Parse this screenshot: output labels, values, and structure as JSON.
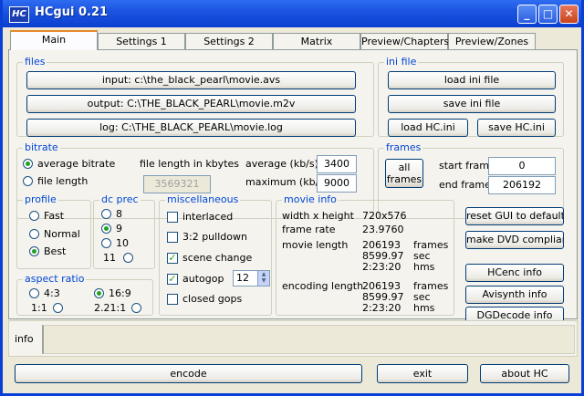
{
  "window": {
    "title": "HCgui 0.21",
    "icon_text": "HC",
    "minimize": "_",
    "maximize": "□",
    "close": "✕",
    "accent": "#0a3fd6"
  },
  "tabs": [
    "Main",
    "Settings 1",
    "Settings 2",
    "Matrix",
    "Preview/Chapters",
    "Preview/Zones"
  ],
  "files": {
    "title": "files",
    "input": "input: c:\\the_black_pearl\\movie.avs",
    "output": "output: C:\\THE_BLACK_PEARL\\movie.m2v",
    "log": "log: C:\\THE_BLACK_PEARL\\movie.log"
  },
  "ini": {
    "title": "ini file",
    "load": "load ini file",
    "save": "save ini file",
    "load_hc": "load HC.ini",
    "save_hc": "save HC.ini"
  },
  "bitrate": {
    "title": "bitrate",
    "average": "average bitrate",
    "file_length": "file length",
    "file_length_label": "file length in kbytes",
    "file_length_value": "3569321",
    "average_label": "average (kb/s)",
    "average_value": "3400",
    "maximum_label": "maximum (kb/s)",
    "maximum_value": "9000"
  },
  "frames": {
    "title": "frames",
    "all": "all\nframes",
    "start_label": "start frame",
    "start_value": "0",
    "end_label": "end frame",
    "end_value": "206192"
  },
  "profile": {
    "title": "profile",
    "fast": "Fast",
    "normal": "Normal",
    "best": "Best"
  },
  "dcprec": {
    "title": "dc prec",
    "v8": "8",
    "v9": "9",
    "v10": "10",
    "v11": "11"
  },
  "misc": {
    "title": "miscellaneous",
    "interlaced": "interlaced",
    "pulldown": "3:2 pulldown",
    "scene": "scene change",
    "autogop": "autogop",
    "autogop_value": "12",
    "closed": "closed gops"
  },
  "aspect": {
    "title": "aspect ratio",
    "a43": "4:3",
    "a169": "16:9",
    "a11": "1:1",
    "a221": "2.21:1"
  },
  "movie": {
    "title": "movie info",
    "wh_label": "width x height",
    "wh": "720x576",
    "fr_label": "frame rate",
    "fr": "23.9760",
    "ml_label": "movie length",
    "ml_frames": "206193",
    "ml_sec": "8599.97",
    "ml_hms": "2:23:20",
    "el_label": "encoding length",
    "el_frames": "206193",
    "el_sec": "8599.97",
    "el_hms": "2:23:20",
    "u_frames": "frames",
    "u_sec": "sec",
    "u_hms": "hms"
  },
  "side": {
    "reset": "reset GUI to default",
    "dvd": "make DVD compliant",
    "hcenc": "HCenc info",
    "avisynth": "Avisynth info",
    "dgdecode": "DGDecode info"
  },
  "info": {
    "label": "info"
  },
  "bottom": {
    "encode": "encode",
    "exit": "exit",
    "about": "about HC"
  }
}
